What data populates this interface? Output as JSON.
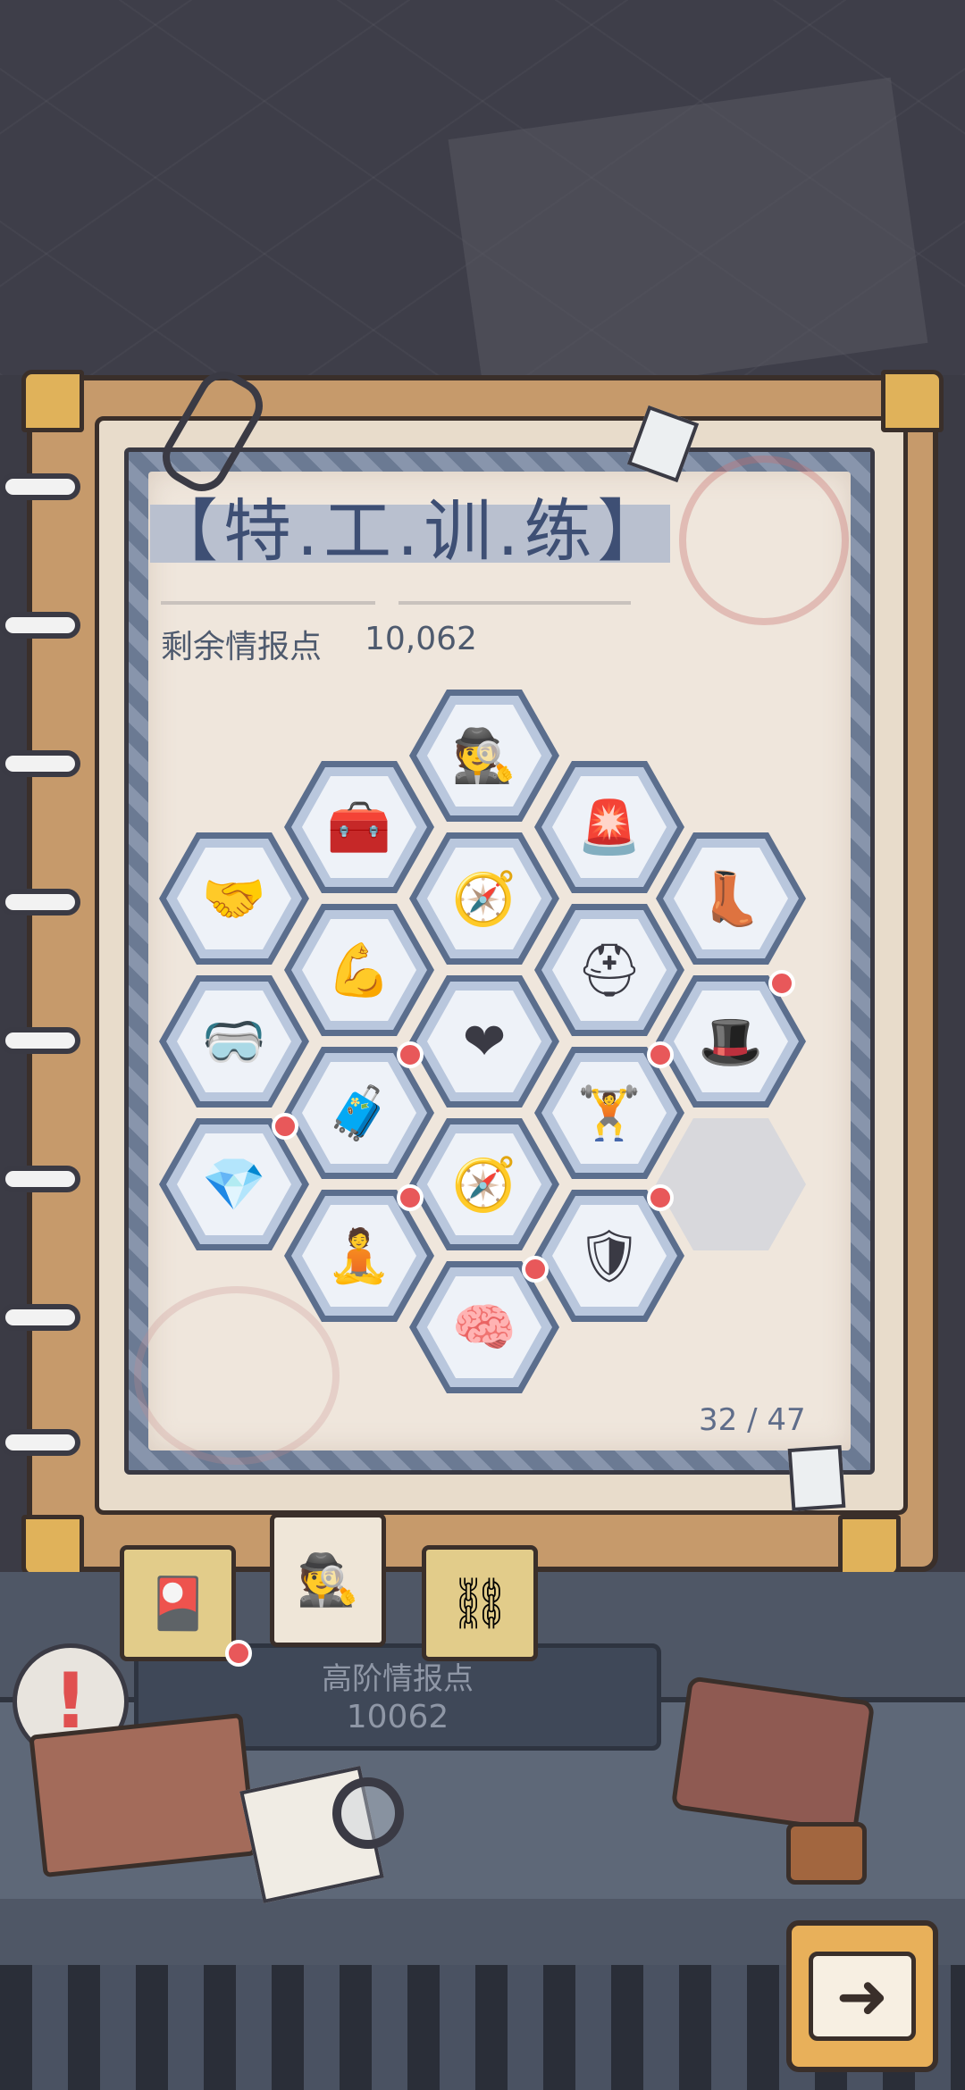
{
  "header": {
    "title": "【特.工.训.练】",
    "points_label": "剩余情报点",
    "points_value": "10,062",
    "progress": "32 / 47"
  },
  "skills": [
    {
      "name": "disguise-agent-icon",
      "glyph": "🕵"
    },
    {
      "name": "toolbox-icon",
      "glyph": "🧰"
    },
    {
      "name": "alarm-siren-icon",
      "glyph": "🚨"
    },
    {
      "name": "handshake-icon",
      "glyph": "🤝"
    },
    {
      "name": "compass-icon",
      "glyph": "🧭"
    },
    {
      "name": "boot-icon",
      "glyph": "👢"
    },
    {
      "name": "strongman-icon",
      "glyph": "💪"
    },
    {
      "name": "helmet-agent-icon",
      "glyph": "⛑"
    },
    {
      "name": "goggles-agent-icon",
      "glyph": "🥽"
    },
    {
      "name": "heart-jar-icon",
      "glyph": "❤"
    },
    {
      "name": "hat-agent-icon",
      "glyph": "🎩"
    },
    {
      "name": "treasure-chest-icon",
      "glyph": "🧳"
    },
    {
      "name": "dumbbell-icon",
      "glyph": "🏋"
    },
    {
      "name": "crystal-hands-icon",
      "glyph": "💎"
    },
    {
      "name": "compass-rose-icon",
      "glyph": "🧭"
    },
    {
      "name": "meditating-monk-icon",
      "glyph": "🧘"
    },
    {
      "name": "shield-arrow-icon",
      "glyph": "🛡"
    },
    {
      "name": "brain-jar-icon",
      "glyph": "🧠"
    }
  ],
  "bottom": {
    "panel_label": "高阶情报点",
    "panel_value": "10062",
    "tabs": [
      {
        "name": "tab-card-icon",
        "glyph": "🎴"
      },
      {
        "name": "tab-agent-icon",
        "glyph": "🕵"
      },
      {
        "name": "tab-chain-icon",
        "glyph": "⛓"
      }
    ],
    "alert_glyph": "!",
    "next_glyph": "➜"
  },
  "colors": {
    "title": "#3e4f74",
    "hex_border": "#5b6e8d",
    "badge": "#e8585a",
    "binder": "#c69a6b"
  }
}
